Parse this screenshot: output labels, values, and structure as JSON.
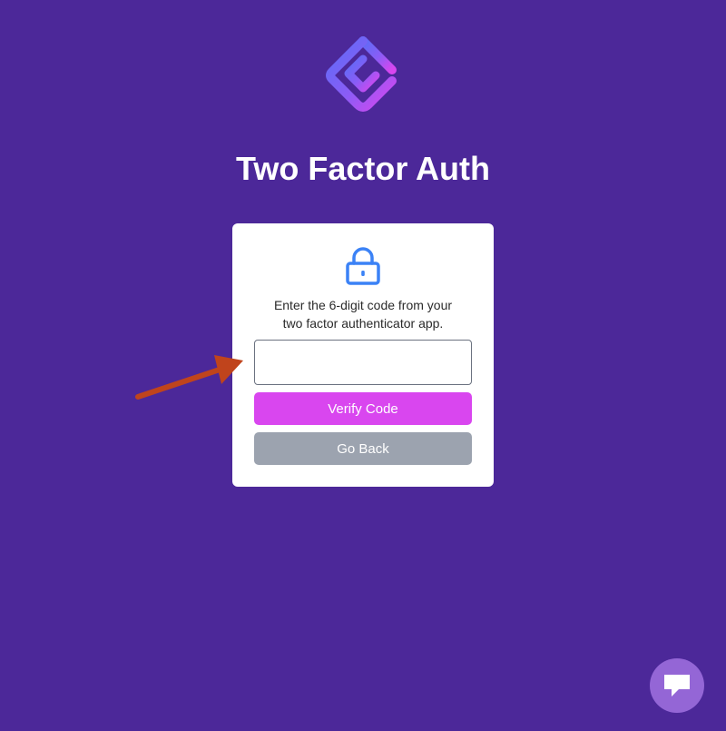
{
  "header": {
    "logo_icon": "brand-logo-icon",
    "title": "Two Factor Auth"
  },
  "card": {
    "lock_icon": "lock-icon",
    "instructions_line1": "Enter the 6-digit code from your",
    "instructions_line2": "two factor authenticator app.",
    "code_input": {
      "value": "",
      "placeholder": ""
    },
    "verify_label": "Verify Code",
    "back_label": "Go Back"
  },
  "annotation": {
    "arrow_icon": "arrow-icon",
    "arrow_color": "#c0441c"
  },
  "chat": {
    "icon": "chat-bubble-icon"
  },
  "colors": {
    "background": "#4c2899",
    "verify_button": "#d946ef",
    "back_button": "#9ca3af",
    "lock": "#3b82f6",
    "chat_button": "#9466d6"
  }
}
